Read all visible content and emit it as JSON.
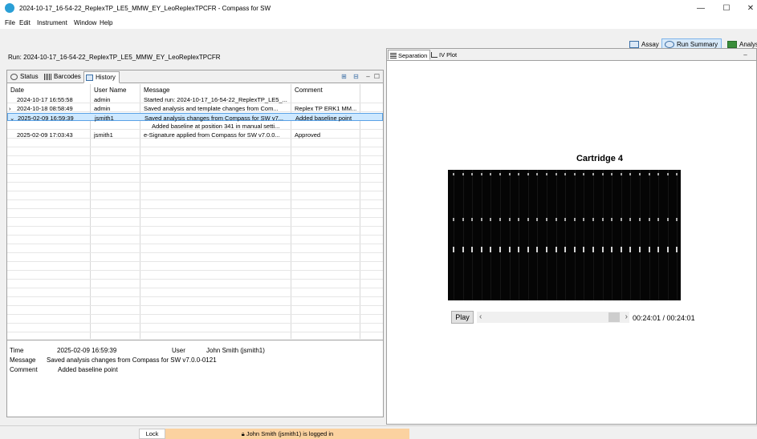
{
  "window": {
    "title": "2024-10-17_16-54-22_ReplexTP_LE5_MMW_EY_LeoReplexTPCFR - Compass for SW",
    "minimize": "—",
    "maximize": "☐",
    "close": "✕"
  },
  "menu": [
    "File",
    "Edit",
    "Instrument",
    "Window",
    "Help"
  ],
  "perspectives": [
    {
      "label": "Assay",
      "icon": "assay-icon"
    },
    {
      "label": "Run Summary",
      "icon": "run-summary-icon"
    },
    {
      "label": "Analys",
      "icon": "analysis-icon"
    }
  ],
  "run_label": "Run: 2024-10-17_16-54-22_ReplexTP_LE5_MMW_EY_LeoReplexTPCFR",
  "left_tabs": [
    {
      "label": "Status",
      "icon": "clock-icon"
    },
    {
      "label": "Barcodes",
      "icon": "barcode-icon"
    },
    {
      "label": "History",
      "icon": "history-icon"
    }
  ],
  "history": {
    "headers": [
      "Date",
      "User Name",
      "Message",
      "Comment"
    ],
    "rows": [
      {
        "expander": "",
        "date": "2024-10-17 16:55:58",
        "user": "admin",
        "message": "Started run: 2024-10-17_16-54-22_ReplexTP_LE5_...",
        "comment": ""
      },
      {
        "expander": "›",
        "date": "2024-10-18 08:58:49",
        "user": "admin",
        "message": "Saved analysis and template changes from Com...",
        "comment": "Replex TP ERK1 MM..."
      },
      {
        "expander": "⌄",
        "date": "2025-02-09 16:59:39",
        "user": "jsmith1",
        "message": "Saved analysis changes from Compass for SW v7...",
        "comment": "Added baseline point"
      },
      {
        "expander": "",
        "date": "",
        "user": "",
        "message": "Added baseline at position 341 in manual setti...",
        "comment": ""
      },
      {
        "expander": "",
        "date": "2025-02-09 17:03:43",
        "user": "jsmith1",
        "message": "e-Signature applied from Compass for SW v7.0.0...",
        "comment": "Approved"
      }
    ]
  },
  "detail": {
    "time_label": "Time",
    "time_value": "2025-02-09 16:59:39",
    "user_label": "User",
    "user_value": "John Smith (jsmith1)",
    "message_label": "Message",
    "message_value": "Saved analysis changes from Compass for SW v7.0.0-0121",
    "comment_label": "Comment",
    "comment_value": "Added baseline point"
  },
  "right_tabs": [
    {
      "label": "Separation",
      "icon": "separation-icon"
    },
    {
      "label": "IV Plot",
      "icon": "iv-plot-icon"
    }
  ],
  "cartridge_title": "Cartridge 4",
  "gel": {
    "lanes": 25,
    "band_rows": 3
  },
  "player": {
    "play_label": "Play",
    "time": "00:24:01 / 00:24:01",
    "position": 1.0
  },
  "status": {
    "lock_label": "Lock",
    "logged_in": "John  Smith (jsmith1) is logged in",
    "logged_in_color": "#fbd2a0"
  }
}
